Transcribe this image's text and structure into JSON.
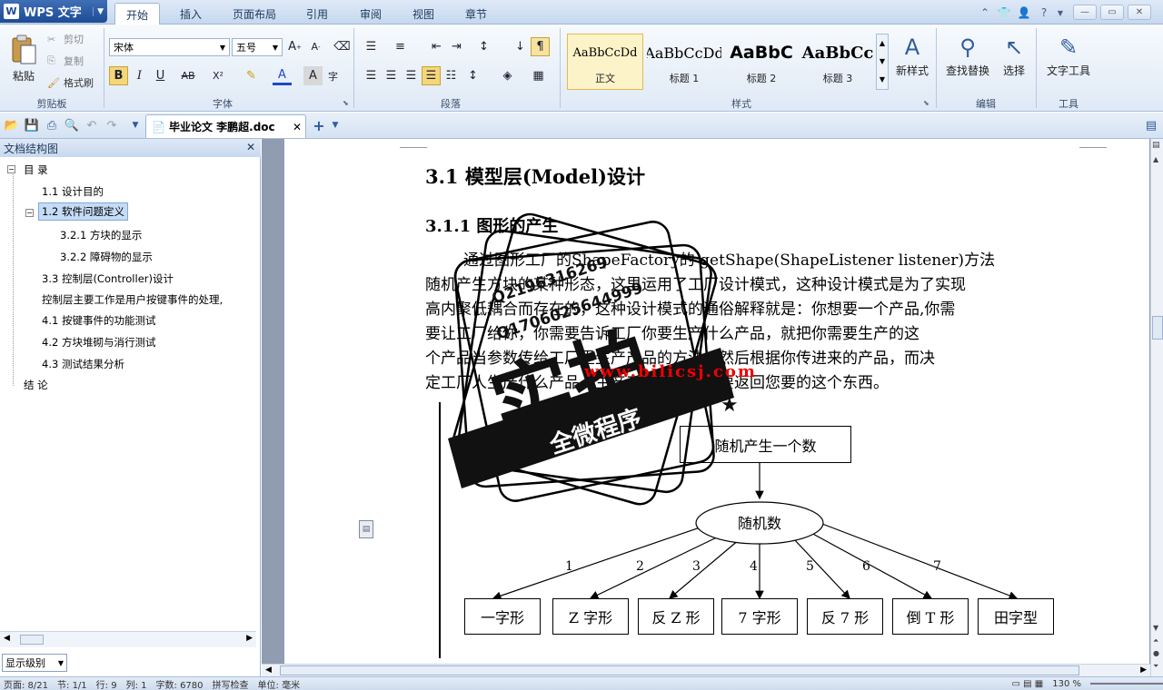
{
  "app": {
    "name": "WPS 文字",
    "logo_letter": "W"
  },
  "ribbon_tabs": [
    "开始",
    "插入",
    "页面布局",
    "引用",
    "审阅",
    "视图",
    "章节"
  ],
  "clipboard": {
    "paste": "粘贴",
    "cut": "剪切",
    "copy": "复制",
    "format_painter": "格式刷",
    "group": "剪贴板"
  },
  "font": {
    "name": "宋体",
    "size": "五号",
    "group": "字体",
    "bold": "B",
    "italic": "I",
    "underline": "U",
    "strike": "AB",
    "sup": "X²"
  },
  "paragraph": {
    "group": "段落"
  },
  "styles": {
    "group": "样式",
    "items": [
      {
        "preview": "AaBbCcDd",
        "name": "正文"
      },
      {
        "preview": "AaBbCcDd",
        "name": "标题 1"
      },
      {
        "preview": "AaBbC",
        "name": "标题 2"
      },
      {
        "preview": "AaBbCc",
        "name": "标题 3"
      }
    ],
    "new_style": "新样式"
  },
  "edit": {
    "find_replace": "查找替换",
    "select": "选择",
    "group": "编辑"
  },
  "tools": {
    "text_tools": "文字工具",
    "group": "工具"
  },
  "document_tab": {
    "title": "毕业论文  李鹏超.doc"
  },
  "doc_map": {
    "title": "文档结构图",
    "items": [
      {
        "label": "目  录"
      },
      {
        "label": "1.1  设计目的"
      },
      {
        "label": "1.2  软件问题定义"
      },
      {
        "label": "3.2.1  方块的显示"
      },
      {
        "label": "3.2.2  障碍物的显示"
      },
      {
        "label": "3.3  控制层(Controller)设计"
      },
      {
        "label": "控制层主要工作是用户按键事件的处理,"
      },
      {
        "label": "4.1  按键事件的功能测试"
      },
      {
        "label": "4.2 方块堆砌与消行测试"
      },
      {
        "label": "4.3  测试结果分析"
      },
      {
        "label": "结  论"
      }
    ],
    "level_select": "显示级别"
  },
  "document": {
    "heading1": "3.1 模型层(Model)设计",
    "heading2": "3.1.1 图形的产生",
    "paragraph_lines": [
      "通过图形工厂的ShapeFactory的 getShape(ShapeListener listener)方法",
      "随机产生方块的某种形态，这里运用了工厂设计模式，这种设计模式是为了实现",
      "高内聚低耦合而存在的，这种设计模式的通俗解释就是：你想要一个产品,你需",
      "要让工厂给你，你需要告诉工厂你要生产什么产品，就把你需要生产的这",
      "个产品当参数传给工厂里生产产品的方法，然后根据你传进来的产品，而决",
      "定工厂人生产什么产品，生产产品后，最后要返回您要的这个东西。"
    ],
    "flow": {
      "top_box": "随机产生一个数",
      "ellipse": "随机数",
      "edge_labels": [
        "1",
        "2",
        "3",
        "4",
        "5",
        "6",
        "7"
      ],
      "shapes": [
        "一字形",
        "Z 字形",
        "反 Z 形",
        "7 字形",
        "反 7 形",
        "倒 T 形",
        "田字型"
      ]
    }
  },
  "watermark": {
    "big": "实拍",
    "ribbon": "全微程序",
    "qq1": "Q2196316269",
    "qq2": "Q1706025644999",
    "url": "www.bilicsj.com"
  },
  "status_bar": {
    "page": "页面: 8/21",
    "section": "节: 1/1",
    "row": "行: 9",
    "col": "列: 1",
    "chars": "字数: 6780",
    "spell": "拼写检查",
    "unit": "单位: 毫米",
    "zoom": "130 %"
  }
}
